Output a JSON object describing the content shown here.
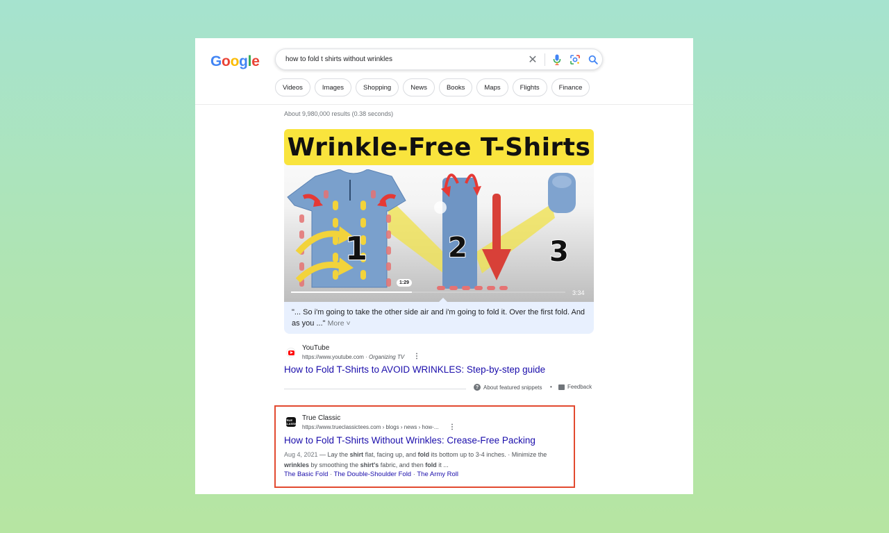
{
  "logo": {
    "letters": [
      "G",
      "o",
      "o",
      "g",
      "l",
      "e"
    ],
    "colors": [
      "#4285f4",
      "#ea4335",
      "#fbbc05",
      "#4285f4",
      "#34a853",
      "#ea4335"
    ]
  },
  "search": {
    "query": "how to fold t shirts without wrinkles"
  },
  "tabs": [
    "Videos",
    "Images",
    "Shopping",
    "News",
    "Books",
    "Maps",
    "Flights",
    "Finance"
  ],
  "stats": "About 9,980,000 results (0.38 seconds)",
  "video": {
    "banner_text": "Wrinkle-Free T-Shirts",
    "step_labels": [
      "1",
      "2",
      "3"
    ],
    "current_time": "1:29",
    "duration": "3:34",
    "progress": 0.44
  },
  "snippet": {
    "text": "\"... So i'm going to take the other side air and i'm going to fold it. Over the first fold. And as you ...\"",
    "more": "More"
  },
  "result1": {
    "site": "YouTube",
    "url": "https://www.youtube.com",
    "channel": "Organizing TV",
    "title": "How to Fold T-Shirts to AVOID WRINKLES: Step-by-step guide"
  },
  "featured": {
    "about": "About featured snippets",
    "bullet": "•",
    "feedback": "Feedback"
  },
  "result2": {
    "favicon_text": "TRUE CLASSIC",
    "site": "True Classic",
    "url": "https://www.trueclassictees.com › blogs › news › how-...",
    "title": "How to Fold T-Shirts Without Wrinkles: Crease-Free Packing",
    "date": "Aug 4, 2021",
    "desc_parts": [
      {
        "t": " — Lay the ",
        "b": false
      },
      {
        "t": "shirt",
        "b": true
      },
      {
        "t": " flat, facing up, and ",
        "b": false
      },
      {
        "t": "fold",
        "b": true
      },
      {
        "t": " its bottom up to 3-4 inches. · Minimize the ",
        "b": false
      },
      {
        "t": "wrinkles",
        "b": true
      },
      {
        "t": " by smoothing the ",
        "b": false
      },
      {
        "t": "shirt's",
        "b": true
      },
      {
        "t": " fabric, and then ",
        "b": false
      },
      {
        "t": "fold",
        "b": true
      },
      {
        "t": " it ...",
        "b": false
      }
    ],
    "sublinks": [
      "The Basic Fold",
      "The Double-Shoulder Fold",
      "The Army Roll"
    ]
  }
}
